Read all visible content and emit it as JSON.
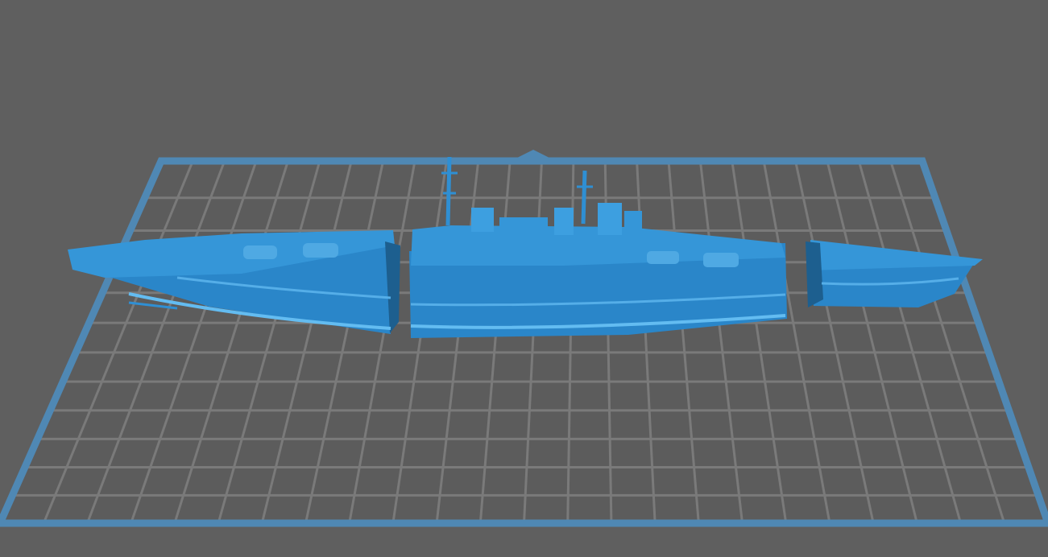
{
  "app": {
    "view": "3d-print-preview",
    "background_color": "#5f5f5f"
  },
  "build_plate": {
    "name": "build-plate",
    "grid": true,
    "border_color": "#4f88b4",
    "grid_line_color": "#7a7a7a",
    "surface_color": "#5c5c5c",
    "front_marker": "triangle"
  },
  "model": {
    "name": "warship-hull",
    "parts": [
      "stern-section",
      "middle-section",
      "bow-section"
    ],
    "color": "#2f8fd3",
    "highlight_color": "#5db6ee",
    "shadow_color": "#1e6ea6"
  }
}
